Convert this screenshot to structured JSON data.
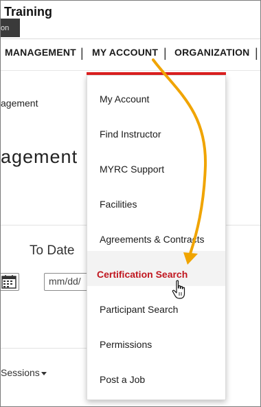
{
  "header": {
    "title": "Training",
    "dark_tab_text": "on"
  },
  "nav": {
    "items": [
      "MANAGEMENT",
      "MY ACCOUNT",
      "ORGANIZATION"
    ],
    "separator": "|"
  },
  "breadcrumb": "agement",
  "page_heading": "agement",
  "filters": {
    "to_date_label": "To Date",
    "date_placeholder": "mm/dd/"
  },
  "sessions_label": "Sessions",
  "dropdown": {
    "items": [
      "My Account",
      "Find Instructor",
      "MYRC Support",
      "Facilities",
      "Agreements & Contracts",
      "Certification Search",
      "Participant Search",
      "Permissions",
      "Post a Job"
    ],
    "active_index": 5
  },
  "colors": {
    "accent_red": "#e02020",
    "active_text": "#c0161f",
    "arrow": "#f0a400"
  }
}
